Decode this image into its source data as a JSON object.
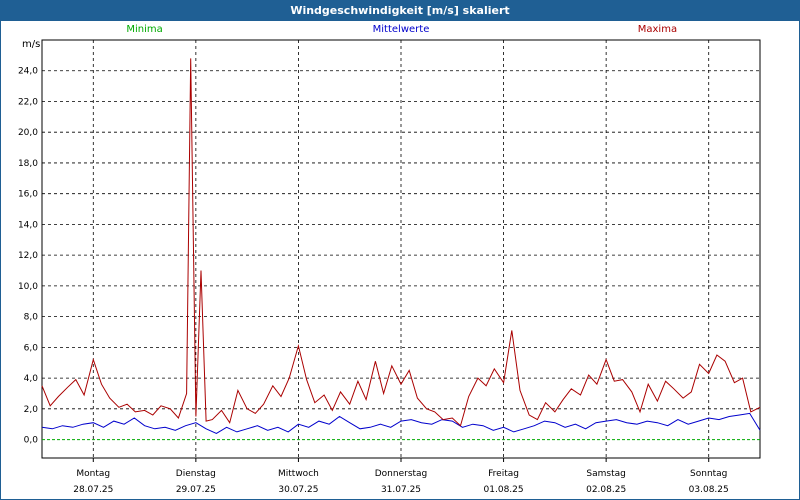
{
  "chart_data": {
    "type": "line",
    "title": "Windgeschwindigkeit [m/s] skaliert",
    "ylabel": "m/s",
    "ylim": [
      -1.2,
      26.0
    ],
    "yticks": [
      0,
      2,
      4,
      6,
      8,
      10,
      12,
      14,
      16,
      18,
      20,
      22,
      24
    ],
    "ytick_labels": [
      "0,0",
      "2,0",
      "4,0",
      "6,0",
      "8,0",
      "10,0",
      "12,0",
      "14,0",
      "16,0",
      "18,0",
      "20,0",
      "22,0",
      "24,0"
    ],
    "x_range_days": [
      0,
      7
    ],
    "x_ticks": [
      {
        "day": "Montag",
        "date": "28.07.25"
      },
      {
        "day": "Dienstag",
        "date": "29.07.25"
      },
      {
        "day": "Mittwoch",
        "date": "30.07.25"
      },
      {
        "day": "Donnerstag",
        "date": "31.07.25"
      },
      {
        "day": "Freitag",
        "date": "01.08.25"
      },
      {
        "day": "Samstag",
        "date": "02.08.25"
      },
      {
        "day": "Sonntag",
        "date": "03.08.25"
      }
    ],
    "grid": true,
    "legend_placement": "top",
    "series": [
      {
        "name": "Minima",
        "color": "#00aa00",
        "x": [
          0,
          7
        ],
        "values": [
          0.0,
          0.0
        ]
      },
      {
        "name": "Mittelwerte",
        "color": "#0000cc",
        "x": [
          0.0,
          0.1,
          0.2,
          0.3,
          0.4,
          0.5,
          0.6,
          0.7,
          0.8,
          0.9,
          1.0,
          1.1,
          1.2,
          1.3,
          1.4,
          1.5,
          1.6,
          1.7,
          1.8,
          1.9,
          2.0,
          2.1,
          2.2,
          2.3,
          2.4,
          2.5,
          2.6,
          2.7,
          2.8,
          2.9,
          3.0,
          3.1,
          3.2,
          3.3,
          3.4,
          3.5,
          3.6,
          3.7,
          3.8,
          3.9,
          4.0,
          4.1,
          4.2,
          4.3,
          4.4,
          4.5,
          4.6,
          4.7,
          4.8,
          4.9,
          5.0,
          5.1,
          5.2,
          5.3,
          5.4,
          5.5,
          5.6,
          5.7,
          5.8,
          5.9,
          6.0,
          6.1,
          6.2,
          6.3,
          6.4,
          6.5,
          6.6,
          6.7,
          6.8,
          6.9,
          7.0
        ],
        "values": [
          0.8,
          0.7,
          0.9,
          0.8,
          1.0,
          1.1,
          0.8,
          1.2,
          1.0,
          1.4,
          0.9,
          0.7,
          0.8,
          0.6,
          0.9,
          1.1,
          0.7,
          0.4,
          0.8,
          0.5,
          0.7,
          0.9,
          0.6,
          0.8,
          0.5,
          1.0,
          0.8,
          1.2,
          1.0,
          1.5,
          1.1,
          0.7,
          0.8,
          1.0,
          0.8,
          1.2,
          1.3,
          1.1,
          1.0,
          1.3,
          1.2,
          0.8,
          1.0,
          0.9,
          0.6,
          0.8,
          0.5,
          0.7,
          0.9,
          1.2,
          1.1,
          0.8,
          1.0,
          0.7,
          1.1,
          1.2,
          1.3,
          1.1,
          1.0,
          1.2,
          1.1,
          0.9,
          1.3,
          1.0,
          1.2,
          1.4,
          1.3,
          1.5,
          1.6,
          1.7,
          0.6
        ]
      },
      {
        "name": "Maxima",
        "color": "#aa0000",
        "x": [
          0.0,
          0.08,
          0.16,
          0.25,
          0.33,
          0.41,
          0.5,
          0.58,
          0.66,
          0.75,
          0.83,
          0.91,
          1.0,
          1.08,
          1.16,
          1.25,
          1.33,
          1.41,
          1.45,
          1.5,
          1.55,
          1.6,
          1.66,
          1.75,
          1.83,
          1.91,
          2.0,
          2.08,
          2.16,
          2.25,
          2.33,
          2.41,
          2.5,
          2.58,
          2.66,
          2.75,
          2.83,
          2.91,
          3.0,
          3.08,
          3.16,
          3.25,
          3.33,
          3.41,
          3.5,
          3.58,
          3.66,
          3.75,
          3.83,
          3.91,
          4.0,
          4.08,
          4.16,
          4.25,
          4.33,
          4.41,
          4.5,
          4.58,
          4.66,
          4.75,
          4.83,
          4.91,
          5.0,
          5.08,
          5.16,
          5.25,
          5.33,
          5.41,
          5.5,
          5.58,
          5.66,
          5.75,
          5.83,
          5.91,
          6.0,
          6.08,
          6.16,
          6.25,
          6.33,
          6.41,
          6.5,
          6.58,
          6.66,
          6.75,
          6.83,
          6.91,
          7.0
        ],
        "values": [
          3.5,
          2.2,
          2.8,
          3.4,
          3.9,
          2.9,
          5.2,
          3.6,
          2.7,
          2.1,
          2.3,
          1.8,
          1.9,
          1.6,
          2.2,
          2.0,
          1.4,
          3.0,
          24.8,
          1.5,
          11.0,
          1.2,
          1.3,
          1.9,
          1.1,
          3.2,
          2.0,
          1.7,
          2.3,
          3.5,
          2.8,
          4.0,
          6.1,
          3.9,
          2.4,
          2.9,
          1.9,
          3.1,
          2.3,
          3.8,
          2.6,
          5.1,
          3.0,
          4.8,
          3.6,
          4.5,
          2.7,
          2.0,
          1.8,
          1.3,
          1.4,
          0.9,
          2.8,
          4.0,
          3.5,
          4.6,
          3.7,
          7.1,
          3.2,
          1.6,
          1.3,
          2.4,
          1.8,
          2.6,
          3.3,
          2.9,
          4.2,
          3.6,
          5.2,
          3.8,
          3.9,
          3.1,
          1.8,
          3.6,
          2.5,
          3.8,
          3.3,
          2.7,
          3.1,
          4.9,
          4.3,
          5.5,
          5.1,
          3.7,
          4.0,
          1.8,
          2.1
        ]
      }
    ]
  }
}
